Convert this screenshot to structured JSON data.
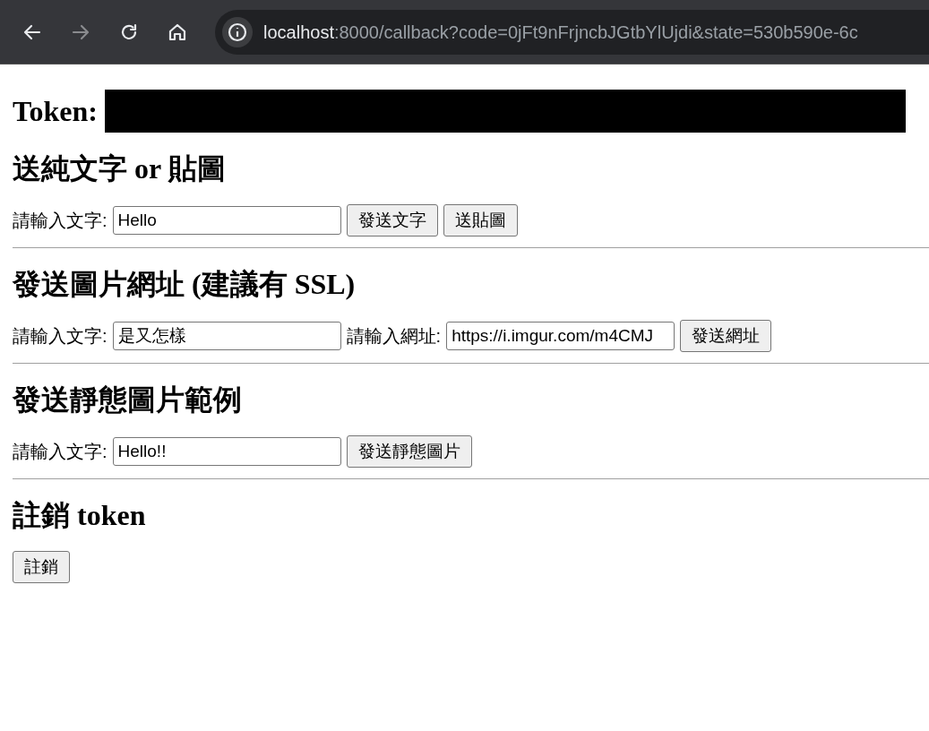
{
  "browser": {
    "url_host": "localhost",
    "url_rest": ":8000/callback?code=0jFt9nFrjncbJGtbYlUjdi&state=530b590e-6c"
  },
  "token_label": "Token:",
  "sections": [
    {
      "title": "送純文字 or 貼圖",
      "fields": [
        {
          "label": "請輸入文字:",
          "value": "Hello"
        }
      ],
      "buttons": [
        "發送文字",
        "送貼圖"
      ]
    },
    {
      "title": "發送圖片網址 (建議有 SSL)",
      "fields": [
        {
          "label": "請輸入文字:",
          "value": "是又怎樣"
        },
        {
          "label": "請輸入網址:",
          "value": "https://i.imgur.com/m4CMJ"
        }
      ],
      "buttons": [
        "發送網址"
      ]
    },
    {
      "title": "發送靜態圖片範例",
      "fields": [
        {
          "label": "請輸入文字:",
          "value": "Hello!!"
        }
      ],
      "buttons": [
        "發送靜態圖片"
      ]
    },
    {
      "title": "註銷 token",
      "buttons": [
        "註銷"
      ]
    }
  ]
}
